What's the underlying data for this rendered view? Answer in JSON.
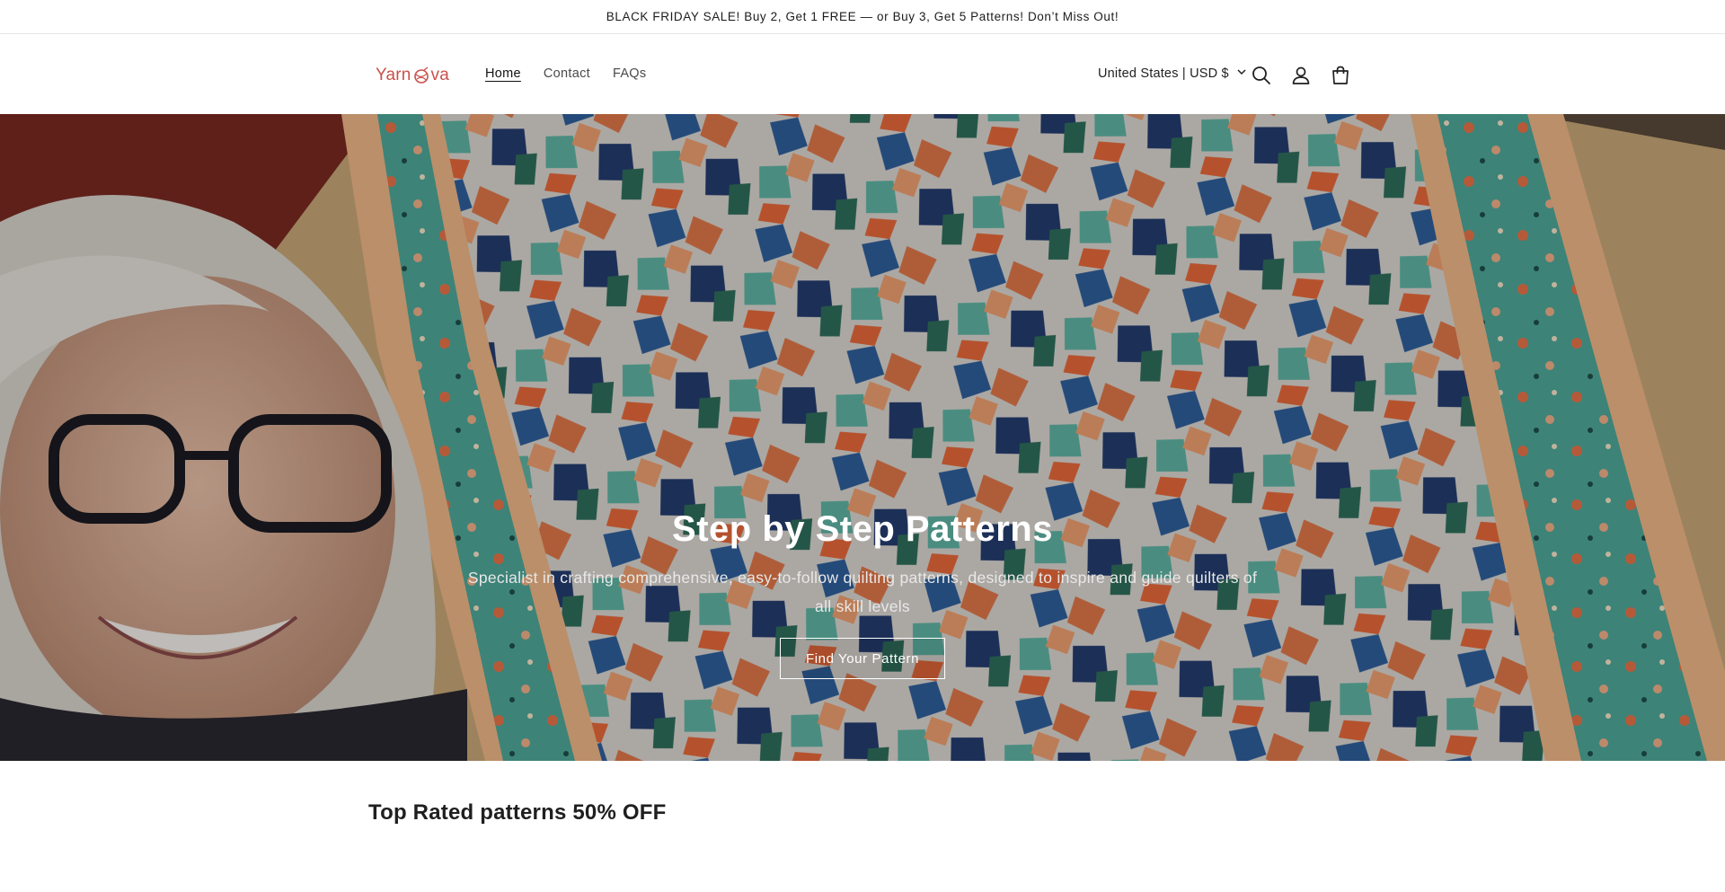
{
  "announcement": {
    "text": "BLACK FRIDAY SALE! Buy 2, Get 1 FREE — or Buy 3, Get 5 Patterns! Don’t Miss Out!"
  },
  "header": {
    "logo": {
      "before": "Yarn",
      "after": "va"
    },
    "nav": [
      {
        "label": "Home",
        "active": true
      },
      {
        "label": "Contact",
        "active": false
      },
      {
        "label": "FAQs",
        "active": false
      }
    ],
    "country_selector": "United States | USD $",
    "icons": [
      "search-icon",
      "account-icon",
      "cart-icon"
    ],
    "brand_color": "#c8514b"
  },
  "hero": {
    "title": "Step by Step Patterns",
    "subtitle": "Specialist in crafting comprehensive, easy-to-follow quilting patterns, designed to inspire and guide quilters of all skill levels",
    "button_label": "Find Your Pattern"
  },
  "featured": {
    "title": "Top Rated patterns 50% OFF"
  }
}
